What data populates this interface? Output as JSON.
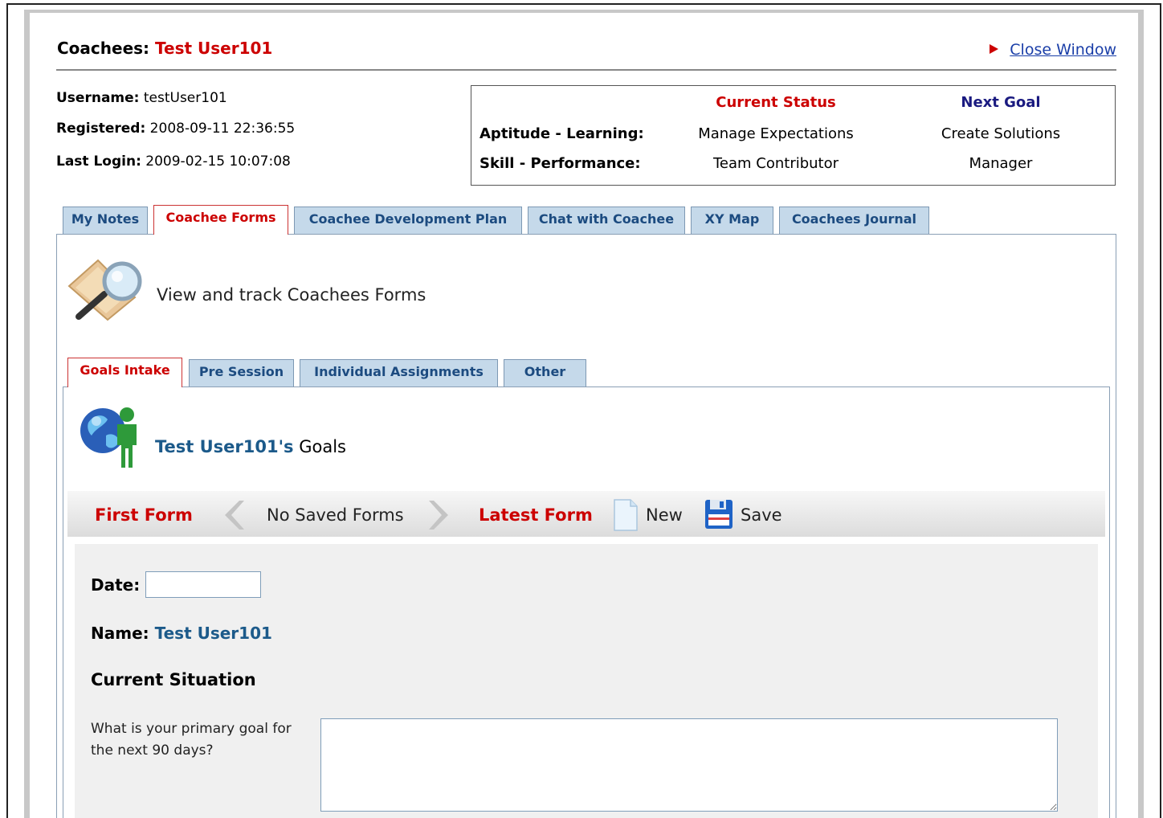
{
  "header": {
    "title_prefix": "Coachees: ",
    "title_name": "Test User101",
    "close_label": "Close Window"
  },
  "user_info": {
    "username_label": "Username:",
    "username_value": " testUser101",
    "registered_label": "Registered:",
    "registered_value": " 2008-09-11 22:36:55",
    "last_login_label": "Last Login:",
    "last_login_value": " 2009-02-15 10:07:08"
  },
  "status": {
    "current_status_header": "Current Status",
    "next_goal_header": "Next Goal",
    "rows": [
      {
        "label": "Aptitude - Learning:",
        "current": "Manage Expectations",
        "next": "Create Solutions"
      },
      {
        "label": "Skill - Performance:",
        "current": "Team Contributor",
        "next": "Manager"
      }
    ]
  },
  "main_tabs": [
    "My Notes",
    "Coachee Forms",
    "Coachee Development Plan",
    "Chat with Coachee",
    "XY Map",
    "Coachees Journal"
  ],
  "main_tab_active": "Coachee Forms",
  "forms_panel": {
    "description": "View and track Coachees Forms"
  },
  "form_tabs": [
    "Goals Intake",
    "Pre Session",
    "Individual Assignments",
    "Other"
  ],
  "form_tab_active": "Goals Intake",
  "goals": {
    "name_possessive": "Test User101's",
    "suffix": " Goals"
  },
  "toolbar": {
    "first_form": "First Form",
    "saved_forms": "No Saved Forms",
    "latest_form": "Latest Form",
    "new_label": "New",
    "save_label": "Save"
  },
  "form": {
    "date_label": "Date:",
    "date_value": "",
    "name_label": "Name:",
    "name_value": "Test User101",
    "section_heading": "Current Situation",
    "question_1": "What is your primary goal for the next 90 days?",
    "answer_1": ""
  },
  "colors": {
    "accent_red": "#cc0000",
    "link_blue": "#1a3ea8",
    "tab_blue": "#c5d9ea",
    "tab_text": "#1c4b80"
  }
}
